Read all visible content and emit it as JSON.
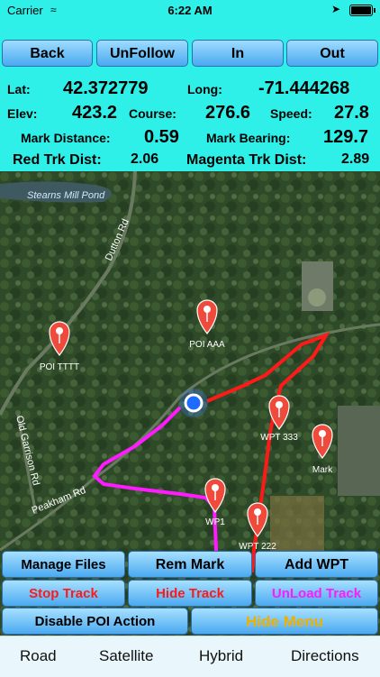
{
  "status": {
    "carrier": "Carrier",
    "time": "6:22 AM"
  },
  "top_buttons": {
    "back": "Back",
    "unfollow": "UnFollow",
    "in": "In",
    "out": "Out"
  },
  "readouts": {
    "lat_label": "Lat:",
    "lat": "42.372779",
    "long_label": "Long:",
    "long": "-71.444268",
    "elev_label": "Elev:",
    "elev": "423.2",
    "course_label": "Course:",
    "course": "276.6",
    "speed_label": "Speed:",
    "speed": "27.8",
    "mark_distance_label": "Mark Distance:",
    "mark_distance": "0.59",
    "mark_bearing_label": "Mark Bearing:",
    "mark_bearing": "129.7",
    "red_trk_label": "Red Trk Dist:",
    "red_trk": "2.06",
    "magenta_trk_label": "Magenta Trk Dist:",
    "magenta_trk": "2.89"
  },
  "map": {
    "labels": {
      "pond": "Stearns Mill Pond",
      "dutton": "Dutton Rd",
      "old_garrison": "Old Garrison Rd",
      "peakham": "Peakham Rd"
    },
    "pins": {
      "poi_aaa": "POI AAA",
      "poi_tttt": "POI TTTT",
      "wpt_333": "WPT 333",
      "mark": "Mark",
      "wp1": "WP1",
      "wpt_222": "WPT 222"
    }
  },
  "action_buttons": {
    "manage_files": "Manage Files",
    "rem_mark": "Rem Mark",
    "add_wpt": "Add WPT",
    "stop_track": "Stop Track",
    "hide_track": "Hide Track",
    "unload_track": "UnLoad Track",
    "disable_poi": "Disable POI Action",
    "hide_menu": "Hide Menu"
  },
  "tabs": {
    "road": "Road",
    "satellite": "Satellite",
    "hybrid": "Hybrid",
    "directions": "Directions"
  },
  "colors": {
    "cyan": "#2ef0e8",
    "button_blue": "#4aa9f0",
    "red_track": "#ff1a1a",
    "magenta_track": "#ff1aff",
    "pin": "#ef4a3c",
    "gold": "#f0b000"
  }
}
